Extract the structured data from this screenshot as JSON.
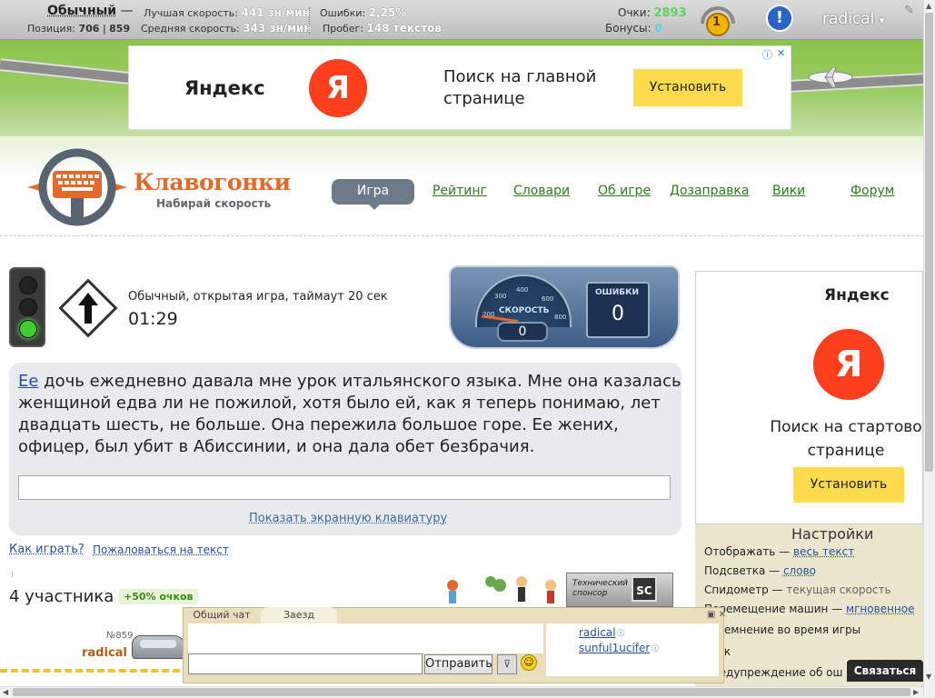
{
  "topbar": {
    "mode": "Обычный",
    "mode_dash": "—",
    "position_label": "Позиция:",
    "position_current": "706",
    "position_separator": "|",
    "position_total": "859",
    "best_speed_label": "Лучшая скорость:",
    "best_speed_value": "441 зн/мин",
    "avg_speed_label": "Средняя скорость:",
    "avg_speed_value": "343 зн/мин",
    "errors_label": "Ошибки:",
    "errors_value": "2,25%",
    "mileage_label": "Пробег:",
    "mileage_value": "148 текстов",
    "points_label": "Очки:",
    "points_value": "2893",
    "bonuses_label": "Бонусы:",
    "bonuses_value": "0",
    "medal_value": "1",
    "alert_icon_text": "!",
    "username": "radical",
    "dropdown_icon_text": "▾"
  },
  "ad_top": {
    "logo": "Яндекс",
    "circle_letter": "Я",
    "text": "Поиск на главной странице",
    "button": "Установить",
    "info_icon_text": "ⓘ",
    "close_icon_text": "✕"
  },
  "header": {
    "logo_title": "Клавогонки",
    "logo_subtitle": "Набирай скорость",
    "nav": [
      "Игра",
      "Рейтинг",
      "Словари",
      "Об игре",
      "Дозаправка",
      "Вики",
      "Форум"
    ]
  },
  "game": {
    "type": "Обычный, открытая игра, таймаут 20 сек",
    "timer": "01:29",
    "speed_label": "СКОРОСТЬ",
    "speed_value": "0",
    "speed_ticks": [
      "200",
      "300",
      "400",
      "600",
      "800"
    ],
    "errors_label": "ОШИБКИ",
    "errors_value": "0",
    "text_current_word": "Ее",
    "text_rest": " дочь ежедневно давала мне урок итальянского языка. Мне она казалась женщиной едва ли не пожилой, хотя было ей, как я теперь понимаю, лет двадцать шесть, не больше. Она пережила большое горе. Ее жених, офицер, был убит в Абиссинии, и она дала обет безбрачия.",
    "show_keyboard": "Показать экранную клавиатуру",
    "how_to_play": "Как играть?",
    "complain": "Пожаловаться на текст"
  },
  "participants": {
    "count_label": "4 участника",
    "bonus_badge": "+50% очков",
    "sponsor_label": "Технический спонсор",
    "sponsor_logo": "SC",
    "player_number": "№859",
    "player_name": "radical"
  },
  "chat": {
    "tabs": [
      "Общий чат",
      "Заезд"
    ],
    "send_button": "Отправить",
    "filter_icon_text": "⊽",
    "smile_icon_text": "☺",
    "controls_text": "▣ ✕",
    "users": [
      "radical",
      "sunful1ucifer"
    ],
    "user_info_icon_text": "ⓘ"
  },
  "ad_side": {
    "logo": "Яндекс",
    "circle_letter": "Я",
    "text": "Поиск на стартово странице",
    "button": "Установить"
  },
  "settings": {
    "title": "Настройки",
    "rows": [
      {
        "label": "Отображать —",
        "value": "весь текст"
      },
      {
        "label": "Подсветка —",
        "value": "слово"
      },
      {
        "label": "Спидометр —",
        "value": "текущая скорость"
      },
      {
        "label": "Перемещение машин —",
        "value": "мгновенное"
      },
      {
        "label": "Затемнение во время игры",
        "value": ""
      },
      {
        "label": "Звук",
        "value": ""
      },
      {
        "label": "Предупреждение об ош",
        "value": ""
      }
    ],
    "contact_button": "Связаться"
  },
  "colors": {
    "accent_orange": "#e46a2a",
    "nav_green": "#2d7a1f",
    "link_blue": "#2a4f9a",
    "yandex_red": "#fc3f1d",
    "yandex_yellow": "#ffdb4d"
  }
}
